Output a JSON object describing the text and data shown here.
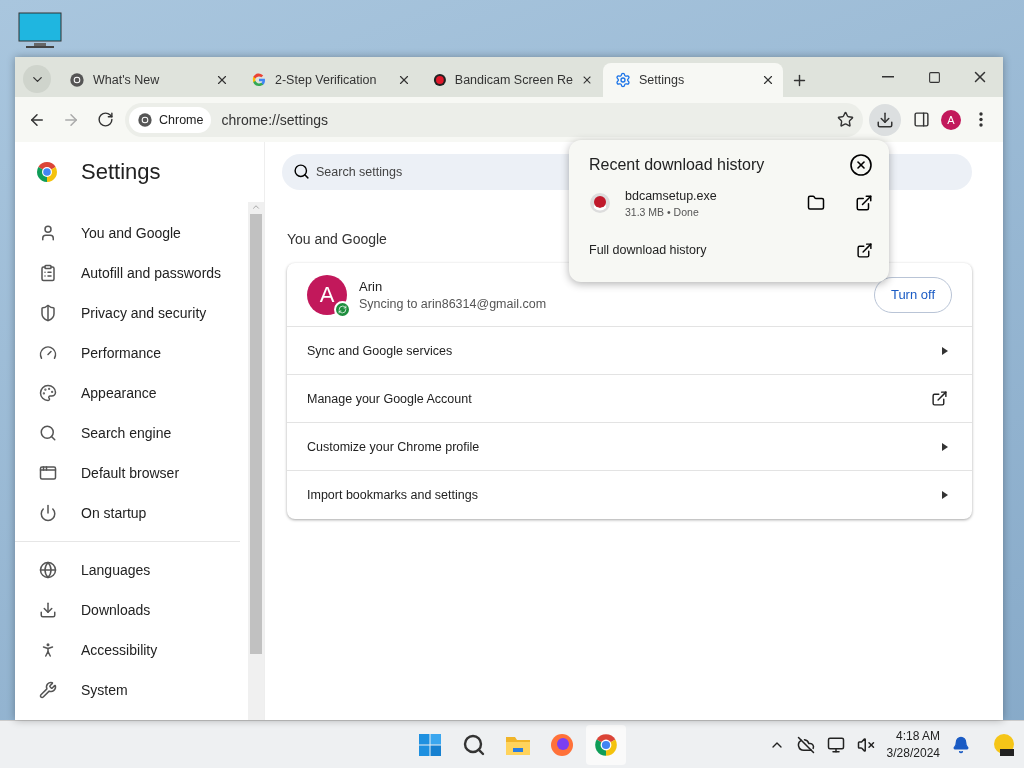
{
  "tabs": [
    {
      "title": "What's New",
      "selected": false
    },
    {
      "title": "2-Step Verification",
      "selected": false
    },
    {
      "title": "Bandicam Screen Re",
      "selected": false
    },
    {
      "title": "Settings",
      "selected": true
    }
  ],
  "address": {
    "chip": "Chrome",
    "url": "chrome://settings"
  },
  "account_avatar": "A",
  "settings": {
    "title": "Settings",
    "search": {
      "placeholder": "Search settings"
    },
    "nav_groups": [
      [
        {
          "label": "You and Google"
        },
        {
          "label": "Autofill and passwords"
        },
        {
          "label": "Privacy and security"
        },
        {
          "label": "Performance"
        },
        {
          "label": "Appearance"
        },
        {
          "label": "Search engine"
        },
        {
          "label": "Default browser"
        },
        {
          "label": "On startup"
        }
      ],
      [
        {
          "label": "Languages"
        },
        {
          "label": "Downloads"
        },
        {
          "label": "Accessibility"
        },
        {
          "label": "System"
        }
      ]
    ],
    "section_title": "You and Google",
    "profile": {
      "avatar": "A",
      "name": "Arin",
      "status": "Syncing to arin86314@gmail.com",
      "button": "Turn off"
    },
    "rows": [
      {
        "label": "Sync and Google services",
        "kind": "submenu"
      },
      {
        "label": "Manage your Google Account",
        "kind": "external"
      },
      {
        "label": "Customize your Chrome profile",
        "kind": "submenu"
      },
      {
        "label": "Import bookmarks and settings",
        "kind": "submenu"
      }
    ]
  },
  "downloads_popup": {
    "title": "Recent download history",
    "items": [
      {
        "name": "bdcamsetup.exe",
        "info": "31.3 MB • Done"
      }
    ],
    "footer": "Full download history"
  },
  "taskbar": {
    "time": "4:18 AM",
    "date": "3/28/2024"
  }
}
